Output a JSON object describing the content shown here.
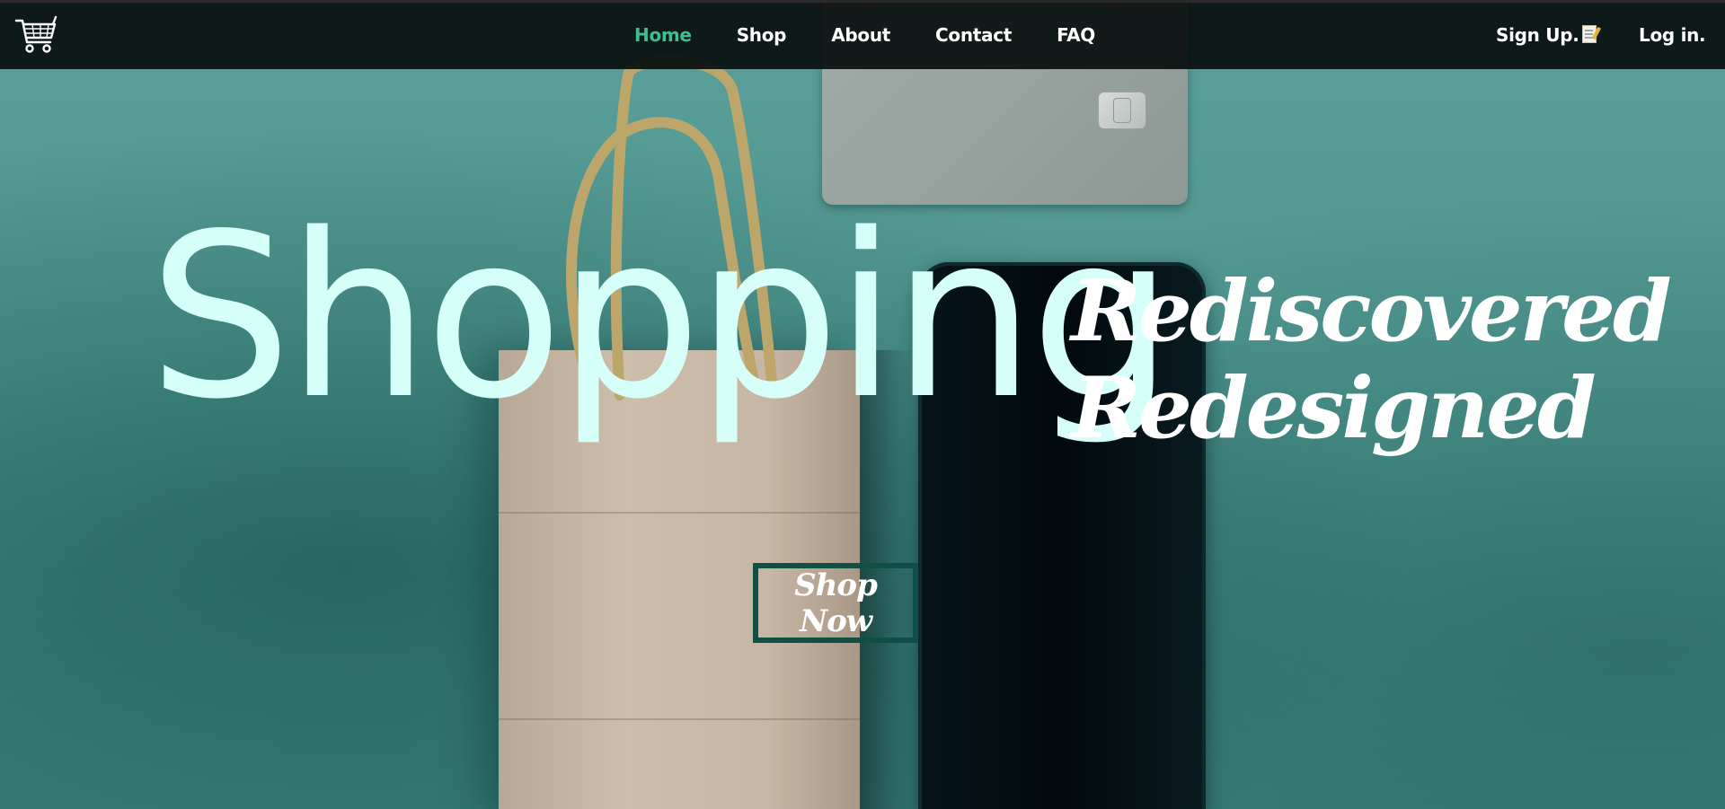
{
  "navbar": {
    "logo_icon": "shopping-cart-icon",
    "links": [
      {
        "label": "Home",
        "active": true
      },
      {
        "label": "Shop",
        "active": false
      },
      {
        "label": "About",
        "active": false
      },
      {
        "label": "Contact",
        "active": false
      },
      {
        "label": "FAQ",
        "active": false
      }
    ],
    "signup_label": "Sign Up.",
    "signup_icon": "memo-icon",
    "login_label": "Log in."
  },
  "hero": {
    "headline": "Shopping",
    "tagline_line1": "Rediscovered",
    "tagline_line2": "Redesigned",
    "cta_label": "Shop Now"
  },
  "colors": {
    "active_link": "#3fbf8f",
    "headline": "#d6fffa",
    "cta_border": "#0f4f44",
    "background_teal": "#4f9590",
    "navbar": "#080e0e"
  }
}
